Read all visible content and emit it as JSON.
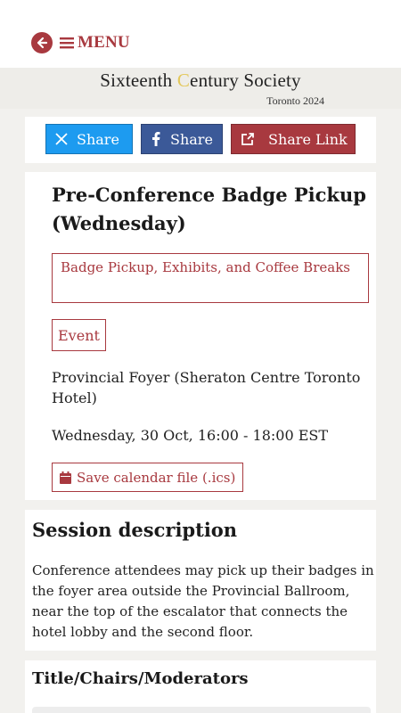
{
  "nav": {
    "back_icon": "arrow-left-circle-icon",
    "menu_icon": "hamburger-icon",
    "menu_label": "MENU",
    "accent_color": "#a8393f"
  },
  "banner": {
    "title_part1": "Sixteenth ",
    "title_accent": "C",
    "title_part2": "entury Society",
    "subtitle": "Toronto 2024",
    "accent_color": "#e3c85b"
  },
  "share": {
    "buttons": [
      {
        "label": "Share",
        "icon": "x-twitter-icon",
        "color": "#1d9bf0"
      },
      {
        "label": "Share",
        "icon": "facebook-icon",
        "color": "#3b5998"
      },
      {
        "label": "Share Link",
        "icon": "external-link-icon",
        "color": "#a8393f"
      }
    ]
  },
  "event": {
    "title": "Pre-Conference Badge Pickup (Wednesday)",
    "track": "Badge Pickup, Exhibits, and Coffee Breaks",
    "type": "Event",
    "location": "Provincial Foyer (Sheraton Centre Toronto Hotel)",
    "datetime": "Wednesday, 30 Oct, 16:00 - 18:00 EST",
    "ics_label": "Save calendar file (.ics)",
    "ics_icon": "calendar-icon"
  },
  "description": {
    "heading": "Session description",
    "text": "Conference attendees may pick up their badges in the foyer area outside the Provincial Ballroom, near the top of the escalator that connects the hotel lobby and the second floor."
  },
  "chairs": {
    "heading": "Title/Chairs/Moderators"
  }
}
